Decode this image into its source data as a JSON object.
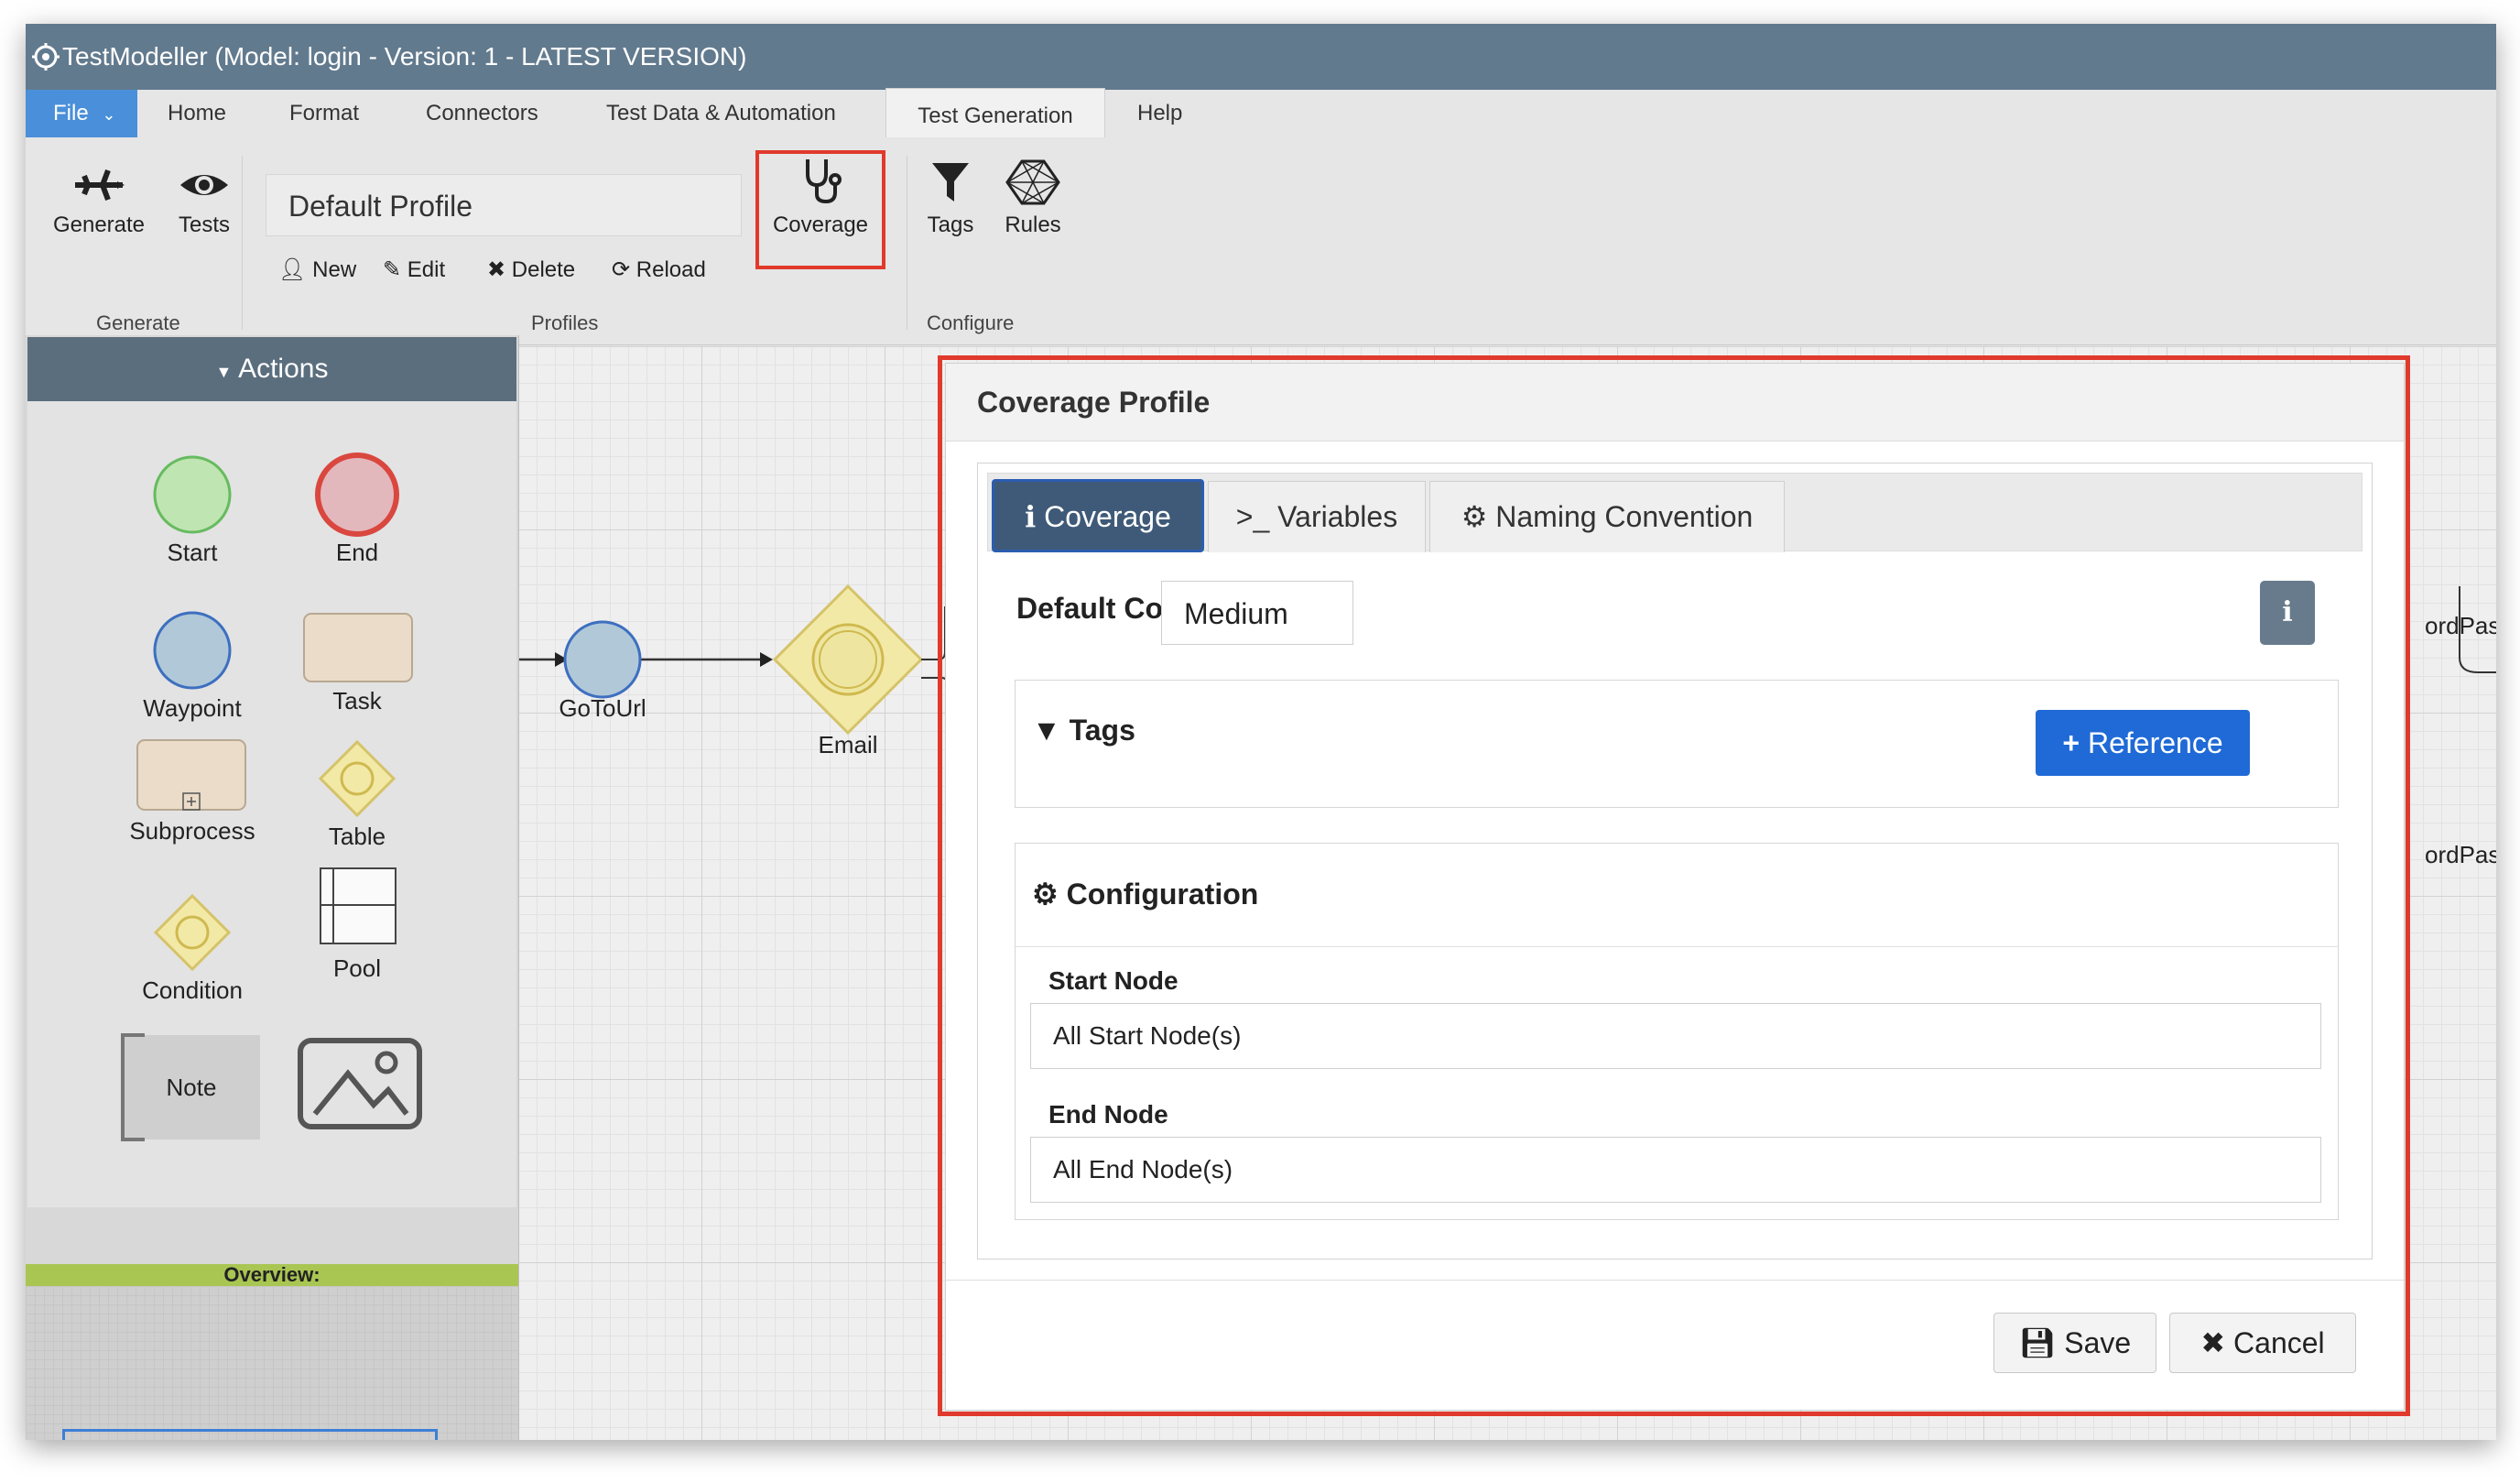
{
  "window": {
    "title": "TestModeller (Model: login - Version: 1 - LATEST VERSION)"
  },
  "menu": {
    "file": "File",
    "items": [
      "Home",
      "Format",
      "Connectors",
      "Test Data & Automation",
      "Test Generation",
      "Help"
    ],
    "active": "Test Generation"
  },
  "ribbon": {
    "generate": {
      "generate_label": "Generate",
      "tests_label": "Tests",
      "group": "Generate"
    },
    "profiles": {
      "profile_name": "Default Profile",
      "new_label": "New",
      "edit_label": "Edit",
      "delete_label": "Delete",
      "reload_label": "Reload",
      "group": "Profiles"
    },
    "coverage_label": "Coverage",
    "configure": {
      "tags_label": "Tags",
      "rules_label": "Rules",
      "group": "Configure"
    }
  },
  "actions_panel": {
    "title": "Actions",
    "shapes": {
      "start": "Start",
      "end": "End",
      "waypoint": "Waypoint",
      "task": "Task",
      "subprocess": "Subprocess",
      "table": "Table",
      "condition": "Condition",
      "pool": "Pool",
      "note": "Note"
    },
    "overview_label": "Overview:"
  },
  "canvas": {
    "nodes": {
      "gotourl": "GoToUrl",
      "email": "Email"
    },
    "edge_labels": [
      "ordPassw",
      "ordPassv"
    ]
  },
  "modal": {
    "title": "Coverage Profile",
    "tabs": {
      "coverage": "Coverage",
      "variables": "Variables",
      "naming": "Naming Convention"
    },
    "default_coverage_label": "Default Coverage",
    "default_coverage_value": "Medium",
    "info_icon_text": "i",
    "tags": {
      "title": "Tags",
      "reference_button": "Reference"
    },
    "configuration": {
      "title": "Configuration",
      "start_node_label": "Start Node",
      "start_node_value": "All Start Node(s)",
      "end_node_label": "End Node",
      "end_node_value": "All End Node(s)"
    },
    "save_label": "Save",
    "cancel_label": "Cancel"
  },
  "colors": {
    "titlebar": "#627a8e",
    "file_menu": "#4a8fd9",
    "highlight": "#e03a2c",
    "active_tab": "#3f5a78",
    "reference_button": "#1f6ad6",
    "overview_bar": "#a9c653"
  }
}
